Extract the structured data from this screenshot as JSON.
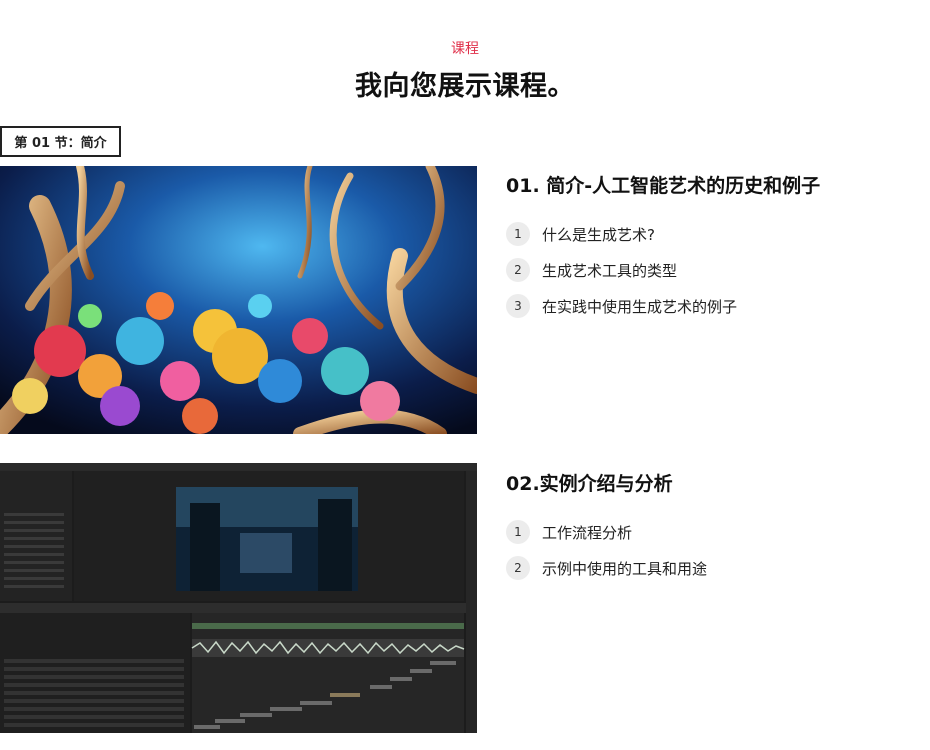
{
  "header": {
    "eyebrow": "课程",
    "title": "我向您展示课程。"
  },
  "section": {
    "tag": "第 01 节：简介"
  },
  "lessons": [
    {
      "title": "01. 简介-人工智能艺术的历史和例子",
      "image": "ai-art-coral-reef-image",
      "topics": [
        {
          "num": "1",
          "label": "什么是生成艺术?"
        },
        {
          "num": "2",
          "label": "生成艺术工具的类型"
        },
        {
          "num": "3",
          "label": "在实践中使用生成艺术的例子"
        }
      ]
    },
    {
      "title": "02.实例介绍与分析",
      "image": "after-effects-editor-screenshot",
      "topics": [
        {
          "num": "1",
          "label": "工作流程分析"
        },
        {
          "num": "2",
          "label": "示例中使用的工具和用途"
        }
      ]
    }
  ],
  "colors": {
    "accent": "#e0304a",
    "badge_bg": "#ececec",
    "text": "#1a1a1a"
  }
}
